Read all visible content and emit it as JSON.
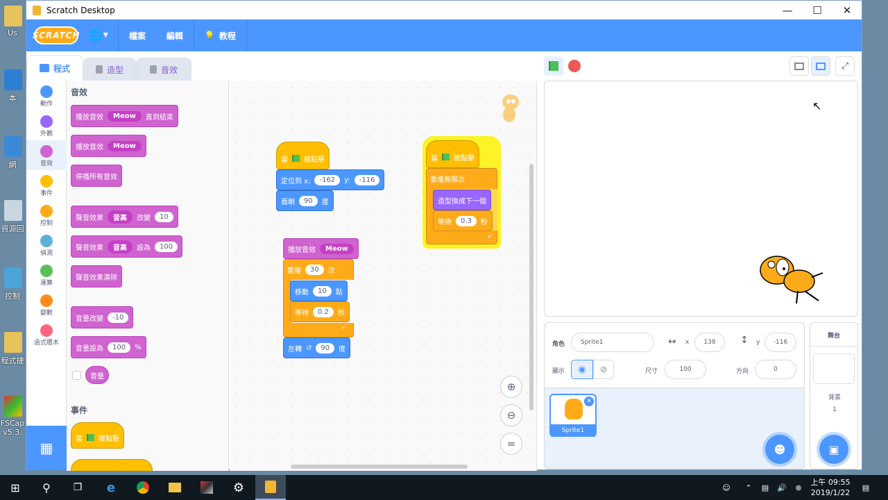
{
  "window": {
    "title": "Scratch Desktop"
  },
  "desktop": [
    "Us",
    "本",
    "網",
    "資源回",
    "控制",
    "程式捷",
    "FSCap\nv5.3."
  ],
  "menu": {
    "file": "檔案",
    "edit": "編輯",
    "tutorials": "教程",
    "logo": "SCRATCH"
  },
  "tabs": {
    "code": "程式",
    "costumes": "造型",
    "sounds": "音效"
  },
  "categories": [
    {
      "label": "動作",
      "color": "#4c97ff"
    },
    {
      "label": "外觀",
      "color": "#9966ff"
    },
    {
      "label": "音效",
      "color": "#cf63cf"
    },
    {
      "label": "事件",
      "color": "#ffbf00"
    },
    {
      "label": "控制",
      "color": "#ffab19"
    },
    {
      "label": "偵測",
      "color": "#5cb1d6"
    },
    {
      "label": "運算",
      "color": "#59c059"
    },
    {
      "label": "變數",
      "color": "#ff8c1a"
    },
    {
      "label": "函式積木",
      "color": "#ff6680"
    }
  ],
  "palette": {
    "sound_heading": "音效",
    "events_heading": "事件",
    "b1": "播放音效",
    "b1_dd": "Meow",
    "b1_tail": "直到結束",
    "b2": "播放音效",
    "b2_dd": "Meow",
    "b3": "停播所有音效",
    "b4": "聲音效果",
    "b4_dd": "音高",
    "b4_mid": "改變",
    "b4_num": "10",
    "b5": "聲音效果",
    "b5_dd": "音高",
    "b5_mid": "設為",
    "b5_num": "100",
    "b6": "聲音效果清除",
    "b7": "音量改變",
    "b7_num": "-10",
    "b8": "音量設為",
    "b8_num": "100",
    "b8_tail": "%",
    "b9": "音量",
    "b10_pre": "當",
    "b10_post": "被點擊"
  },
  "scripts": {
    "s1_hat_pre": "當",
    "s1_hat_post": "被點擊",
    "s1_goto": "定位到 x:",
    "s1_x": "-162",
    "s1_ylabel": "y:",
    "s1_y": "-116",
    "s1_face": "面朝",
    "s1_dir": "90",
    "s1_deg": "度",
    "s2_play": "播放音效",
    "s2_dd": "Meow",
    "s2_repeat": "重複",
    "s2_times": "30",
    "s2_times_unit": "次",
    "s2_move": "移動",
    "s2_steps": "10",
    "s2_steps_unit": "點",
    "s2_wait": "等待",
    "s2_wait_val": "0.2",
    "s2_sec": "秒",
    "s2_turn": "左轉",
    "s2_turn_val": "90",
    "s2_turn_unit": "度",
    "s3_hat_pre": "當",
    "s3_hat_post": "被點擊",
    "s3_forever": "重複無限次",
    "s3_next": "造型換成下一個",
    "s3_wait": "等待",
    "s3_wait_val": "0.3",
    "s3_sec": "秒"
  },
  "sprite": {
    "label_sprite": "角色",
    "name": "Sprite1",
    "x_label": "x",
    "x": "138",
    "y_label": "y",
    "y": "-116",
    "show_label": "顯示",
    "size_label": "尺寸",
    "size": "100",
    "direction_label": "方向",
    "direction": "0",
    "thumb_name": "Sprite1"
  },
  "stage_panel": {
    "title": "舞台",
    "backdrops_label": "背景",
    "backdrops_count": "1"
  },
  "taskbar": {
    "time": "上午 09:55",
    "date": "2019/1/22"
  }
}
